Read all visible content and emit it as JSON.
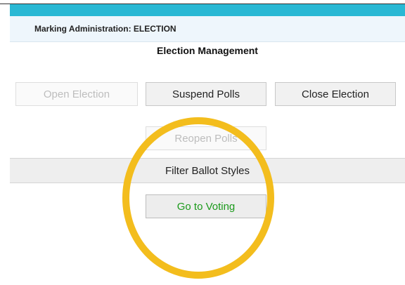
{
  "header": {
    "title": "Marking Administration: ELECTION"
  },
  "section": {
    "title": "Election Management"
  },
  "buttons": {
    "open_election": "Open Election",
    "suspend_polls": "Suspend Polls",
    "close_election": "Close Election",
    "reopen_polls": "Reopen Polls",
    "go_to_voting": "Go to Voting"
  },
  "filter": {
    "label": "Filter Ballot Styles"
  },
  "colors": {
    "top_bar": "#29b8d4",
    "highlight_ring": "#f3bd1d",
    "go_to_voting_text": "#1b9a1b"
  }
}
